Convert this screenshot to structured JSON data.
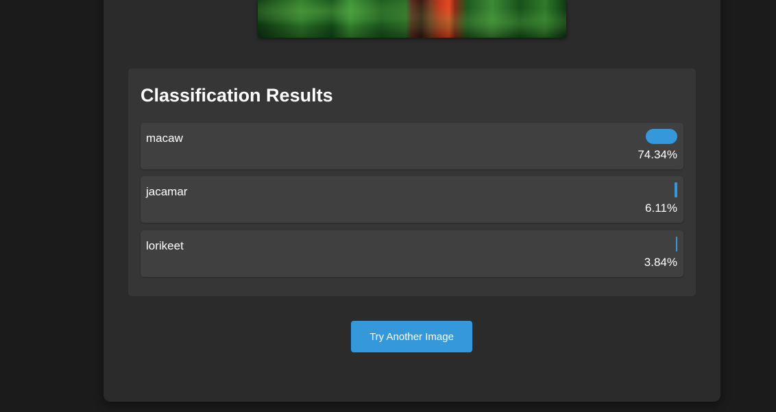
{
  "results": {
    "title": "Classification Results",
    "items": [
      {
        "label": "macaw",
        "percent_text": "74.34%",
        "percent": 74.34
      },
      {
        "label": "jacamar",
        "percent_text": "6.11%",
        "percent": 6.11
      },
      {
        "label": "lorikeet",
        "percent_text": "3.84%",
        "percent": 3.84
      }
    ]
  },
  "actions": {
    "try_again_label": "Try Another Image"
  },
  "colors": {
    "accent": "#3498db",
    "card": "#2b2b2b",
    "panel": "#363636",
    "row": "#404040",
    "background": "#1b1b1b"
  }
}
